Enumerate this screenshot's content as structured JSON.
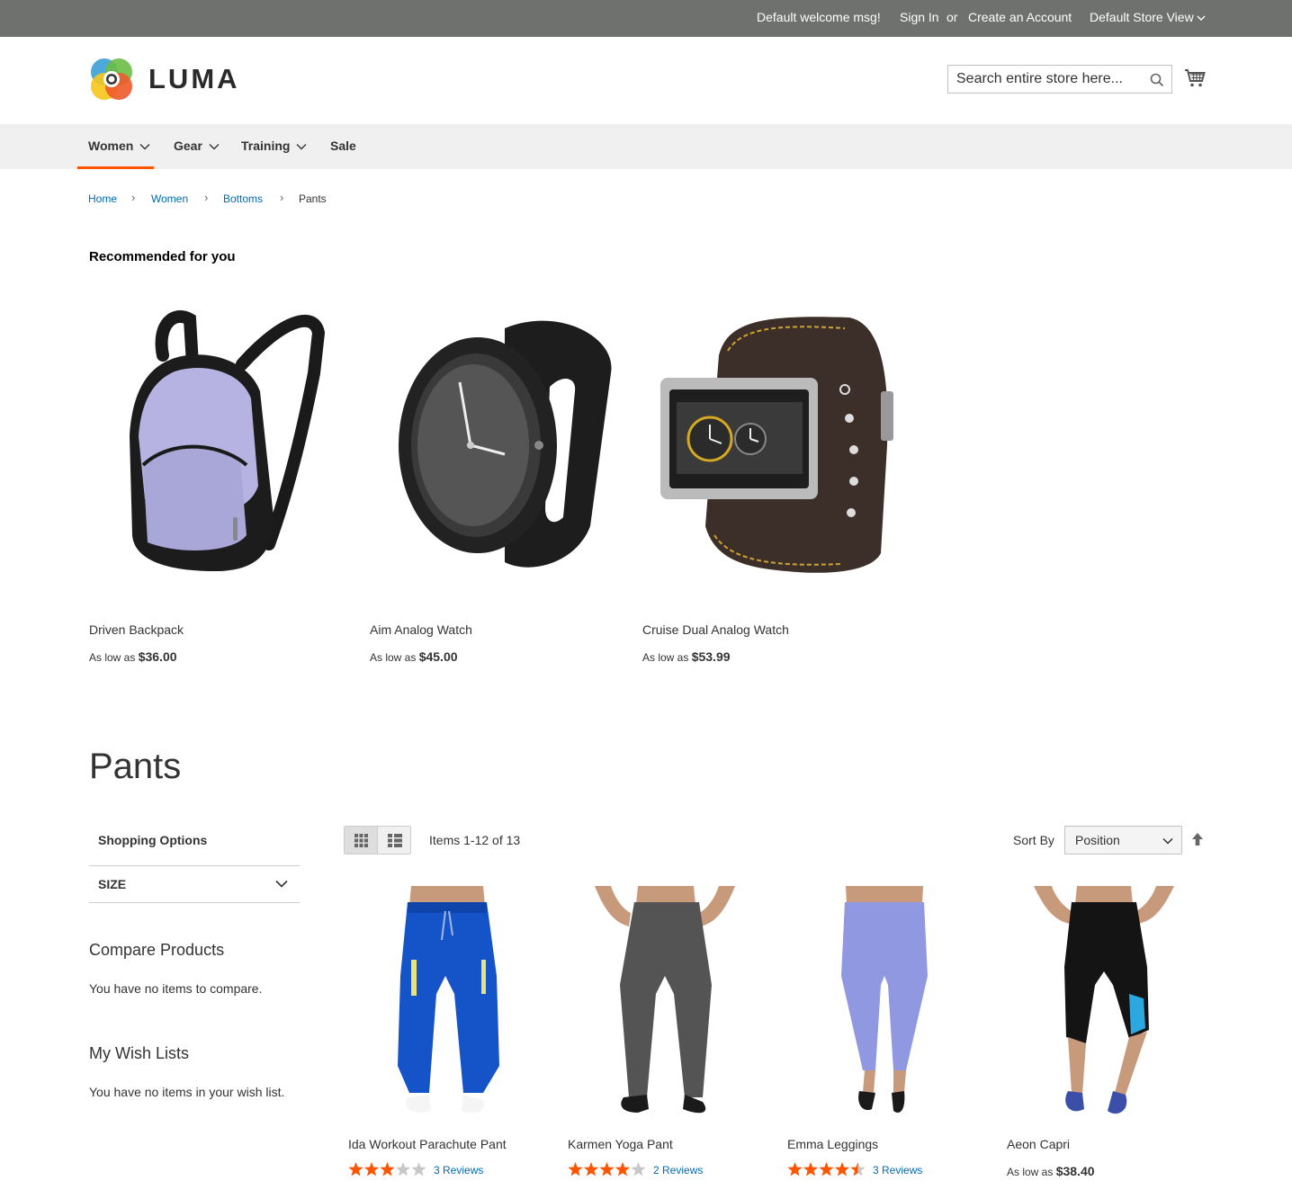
{
  "topbar": {
    "welcome": "Default welcome msg!",
    "sign_in": "Sign In",
    "or": "or",
    "create_account": "Create an Account",
    "store_view": "Default Store View"
  },
  "header": {
    "logo_text": "LUMA",
    "search_placeholder": "Search entire store here..."
  },
  "nav": {
    "items": [
      {
        "label": "Women",
        "has_dropdown": true,
        "active": true
      },
      {
        "label": "Gear",
        "has_dropdown": true
      },
      {
        "label": "Training",
        "has_dropdown": true
      },
      {
        "label": "Sale",
        "has_dropdown": false
      }
    ]
  },
  "breadcrumb": [
    "Home",
    "Women",
    "Bottoms",
    "Pants"
  ],
  "recommended": {
    "title": "Recommended for you",
    "items": [
      {
        "name": "Driven Backpack",
        "price_prefix": "As low as",
        "price": "$36.00"
      },
      {
        "name": "Aim Analog Watch",
        "price_prefix": "As low as",
        "price": "$45.00"
      },
      {
        "name": "Cruise Dual Analog Watch",
        "price_prefix": "As low as",
        "price": "$53.99"
      }
    ]
  },
  "page_title": "Pants",
  "sidebar": {
    "shopping_options": "Shopping Options",
    "filters": [
      {
        "label": "SIZE"
      }
    ],
    "compare_title": "Compare Products",
    "compare_text": "You have no items to compare.",
    "wishlist_title": "My Wish Lists",
    "wishlist_text": "You have no items in your wish list."
  },
  "toolbar": {
    "amount": "Items 1-12 of 13",
    "sort_label": "Sort By",
    "sort_value": "Position"
  },
  "products": [
    {
      "name": "Ida Workout Parachute Pant",
      "rating": 3,
      "reviews": "3  Reviews",
      "color": "#1553c9"
    },
    {
      "name": "Karmen Yoga Pant",
      "rating": 4,
      "reviews": "2  Reviews",
      "color": "#545454"
    },
    {
      "name": "Emma Leggings",
      "rating": 4.5,
      "reviews": "3  Reviews",
      "color": "#8f98e0"
    },
    {
      "name": "Aeon Capri",
      "price_prefix": "As low as",
      "price": "$38.40",
      "color": "#141414"
    }
  ],
  "colors": {
    "accent": "#ff5501",
    "link": "#006bb4",
    "star": "#ff5501",
    "topbar": "#6e716e"
  }
}
